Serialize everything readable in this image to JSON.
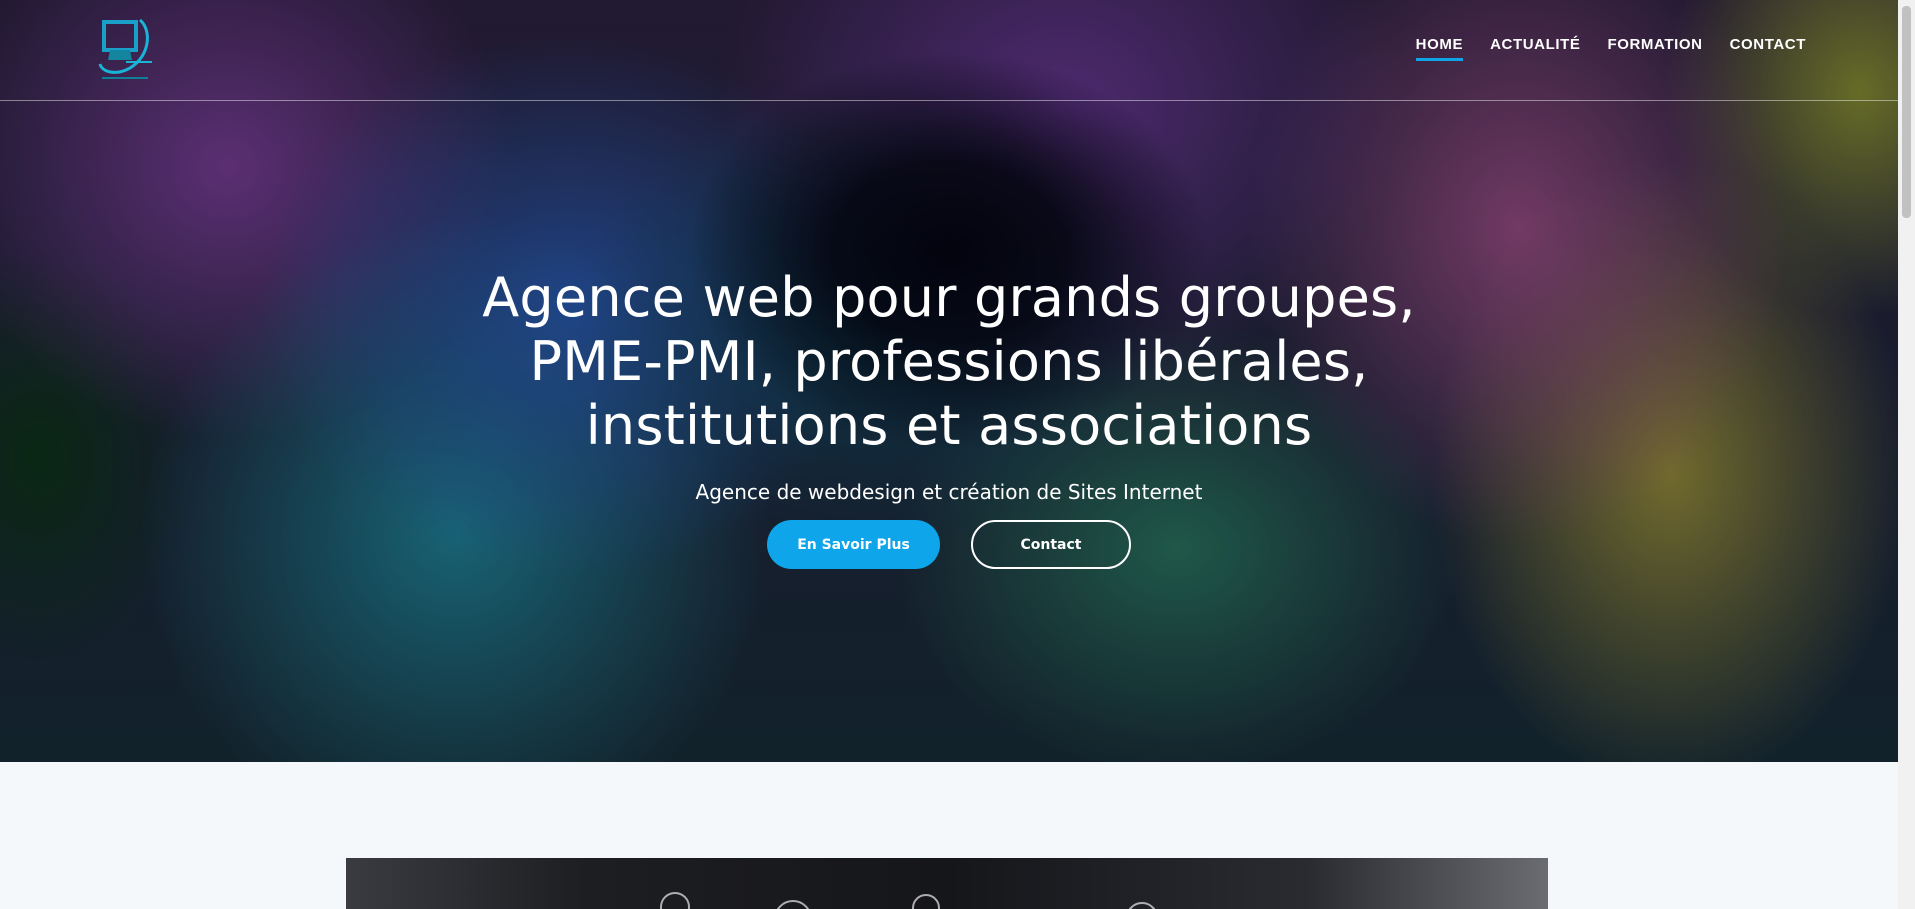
{
  "header": {
    "nav": [
      {
        "label": "HOME",
        "active": true
      },
      {
        "label": "ACTUALITÉ",
        "active": false
      },
      {
        "label": "FORMATION",
        "active": false
      },
      {
        "label": "CONTACT",
        "active": false
      }
    ],
    "logo_icon": "monitor-logo-icon"
  },
  "hero": {
    "title": "Agence web pour grands groupes, PME-PMI, professions libérales, institutions et associations",
    "subtitle": "Agence de webdesign et création de Sites Internet",
    "primary_button": "En Savoir Plus",
    "secondary_button": "Contact"
  },
  "colors": {
    "accent": "#0ea5ea",
    "text_on_hero": "#ffffff",
    "section_background": "#f4f8fb"
  }
}
